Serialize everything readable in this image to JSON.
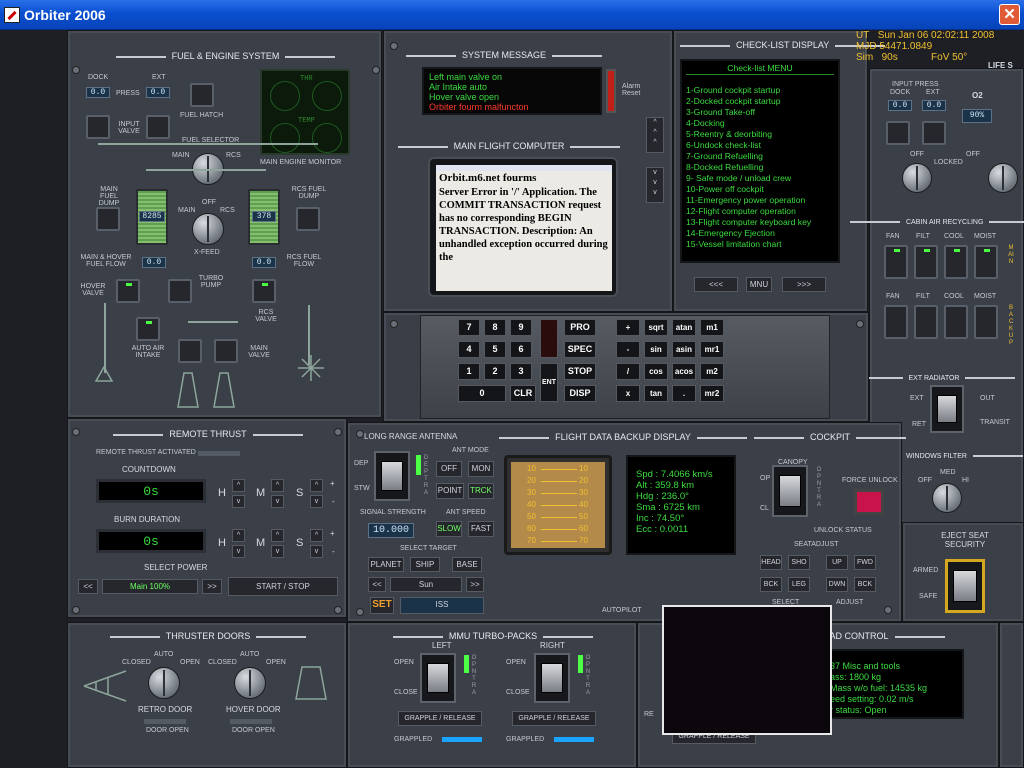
{
  "window": {
    "title": "Orbiter 2006",
    "close": "✕"
  },
  "hud": {
    "ut_label": "UT",
    "ut": "Sun Jan 06 02:02:11 2008",
    "mjd_label": "MJD",
    "mjd": "54471.0849",
    "sim_label": "Sim",
    "sim": "90s",
    "fov": "FoV 50°",
    "life": "LIFE S"
  },
  "fuel": {
    "title": "FUEL & ENGINE SYSTEM",
    "dock": "DOCK",
    "ext": "EXT",
    "press": "PRESS",
    "dock_val": "0.0",
    "ext_val": "0.0",
    "fuel_hatch": "FUEL HATCH",
    "input_valve": "INPUT VALVE",
    "fuel_selector": "FUEL SELECTOR",
    "main": "MAIN",
    "rcs": "RCS",
    "monitor": "MAIN ENGINE MONITOR",
    "thr": "THR",
    "temp": "TEMP",
    "main_fuel_dump": "MAIN FUEL DUMP",
    "rcs_fuel_dump": "RCS FUEL DUMP",
    "main_qty": "8285",
    "rcs_qty": "378",
    "off": "OFF",
    "xfeed": "X-FEED",
    "hover_flow": "MAIN & HOVER FUEL FLOW",
    "hover_flow_val": "0.0",
    "rcs_flow": "RCS FUEL FLOW",
    "rcs_flow_val": "0.0",
    "hover_valve": "HOVER VALVE",
    "turbo_pump": "TURBO PUMP",
    "rcs_valve": "RCS VALVE",
    "auto_air": "AUTO AIR INTAKE",
    "main_valve": "MAIN VALVE"
  },
  "sysmsg": {
    "title": "SYSTEM MESSAGE",
    "lines": [
      "Left main valve on",
      "Air Intake auto",
      "Hover valve open"
    ],
    "alert": "Orbiter fourm malfuncton",
    "alarm_reset": "Alarm Reset"
  },
  "checklist": {
    "title": "CHECK-LIST DISPLAY",
    "menu": "Check-list MENU",
    "items": [
      "1-Ground cockpit startup",
      "2-Docked cockpit startup",
      "3-Ground Take-off",
      "4-Docking",
      "5-Reentry & deorbiting",
      "6-Undock check-list",
      "7-Ground Refuelling",
      "8-Docked Refuelling",
      "9- Safe mode / unload crew",
      "10-Power off cockpit",
      "11-Emergency power operation",
      "12-Flight computer operation",
      "13-Flight computer keyboard key",
      "14-Emergency Ejection",
      "15-Vessel limitation chart"
    ],
    "prev": "<<<",
    "mnu": "MNU",
    "next": ">>>"
  },
  "mfc": {
    "title": "MAIN FLIGHT COMPUTER",
    "page_title": "Orbit.m6.net fourms",
    "text": "Server Error in '/' Application. The COMMIT TRANSACTION request has no corresponding BEGIN TRANSACTION. Description: An unhandled exception occurred during the"
  },
  "keypad": {
    "nums": [
      "7",
      "8",
      "9",
      "4",
      "5",
      "6",
      "1",
      "2",
      "3",
      "0",
      "CLR",
      "ENT"
    ],
    "fn": [
      "PRO",
      "SPEC",
      "STOP",
      "DISP"
    ],
    "math": [
      "+",
      "sqrt",
      "atan",
      "m1",
      "-",
      "sin",
      "asin",
      "mr1",
      "/",
      "cos",
      "acos",
      "m2",
      "x",
      "tan",
      ".",
      "mr2"
    ]
  },
  "lifesup": {
    "input_press": "INPUT PRESS",
    "dock": "DOCK",
    "ext": "EXT",
    "dock_val": "0.0",
    "ext_val": "0.0",
    "o2": "O2",
    "o2_val": "90%",
    "off": "OFF",
    "locked": "LOCKED",
    "cabin_air": "CABIN AIR RECYCLING",
    "fan": "FAN",
    "filt": "FILT",
    "cool": "COOL",
    "moist": "MOIST",
    "main": "MAIN",
    "backup": "BACKUP",
    "ext_radiator": "EXT RADIATOR",
    "ext_lbl": "EXT",
    "ret": "RET",
    "out": "OUT",
    "transit": "TRANSIT",
    "windows_filter": "WINDOWS FILTER",
    "med": "MED",
    "hi": "HI",
    "off2": "OFF"
  },
  "remote": {
    "title": "REMOTE THRUST",
    "activated": "REMOTE THRUST ACTIVATED",
    "countdown": "COUNTDOWN",
    "countdown_val": "0s",
    "burn": "BURN DURATION",
    "burn_val": "0s",
    "h": "H",
    "m": "M",
    "s": "S",
    "select_power": "SELECT POWER",
    "power_val": "Main 100%",
    "start_stop": "START / STOP"
  },
  "antenna": {
    "title": "LONG RANGE ANTENNA",
    "dep": "DEP",
    "stw": "STW",
    "ant_mode": "ANT MODE",
    "off": "OFF",
    "mon": "MON",
    "point": "POINT",
    "trck": "TRCK",
    "signal": "SIGNAL STRENGTH",
    "signal_val": "10.000",
    "ant_speed": "ANT SPEED",
    "slow": "SLOW",
    "fast": "FAST",
    "select_target": "SELECT TARGET",
    "planet": "PLANET",
    "ship": "SHIP",
    "base": "BASE",
    "target": "Sun",
    "set": "SET",
    "set_val": "ISS"
  },
  "fdb": {
    "title": "FLIGHT DATA BACKUP DISPLAY",
    "ladder": [
      "10",
      "20",
      "30",
      "40",
      "50",
      "60",
      "70"
    ],
    "lines": [
      "Spd : 7.4066 km/s",
      "Alt : 359.8 km",
      "Hdg : 236.0°",
      "Sma : 6725 km",
      "Inc : 74.50°",
      "Ecc : 0.0011"
    ],
    "autopilot": "AUTOPILOT"
  },
  "cockpit": {
    "title": "COCKPIT",
    "canopy": "CANOPY",
    "op": "OP",
    "cl": "CL",
    "force_unlock": "FORCE UNLOCK",
    "unlock_status": "UNLOCK STATUS",
    "seat": "SEATADJUST",
    "head": "HEAD",
    "sho": "SHO",
    "up": "UP",
    "fwd": "FWD",
    "bck": "BCK",
    "leg": "LEG",
    "dwn": "DWN",
    "bck2": "BCK",
    "select": "SELECT",
    "adjust": "ADJUST"
  },
  "eject": {
    "title": "EJECT SEAT SECURITY",
    "armed": "ARMED",
    "safe": "SAFE"
  },
  "doors": {
    "title": "THRUSTER DOORS",
    "closed": "CLOSED",
    "auto": "AUTO",
    "open": "OPEN",
    "retro": "RETRO DOOR",
    "hover": "HOVER DOOR",
    "door_open": "DOOR OPEN"
  },
  "mmu": {
    "title": "MMU TURBO-PACKS",
    "left": "LEFT",
    "right": "RIGHT",
    "open": "OPEN",
    "close": "CLOSE",
    "grapple": "GRAPPLE / RELEASE",
    "grappled": "GRAPPLED"
  },
  "payload": {
    "title": "LOAD CONTROL",
    "lines": [
      "37 Misc and tools",
      "ass: 1800 kg",
      "Mass w/o fuel: 14535 kg",
      "eed setting: 0.02 m/s",
      "r status: Open"
    ],
    "grapple": "GRAPPLE / RELEASE",
    "re": "RE"
  }
}
